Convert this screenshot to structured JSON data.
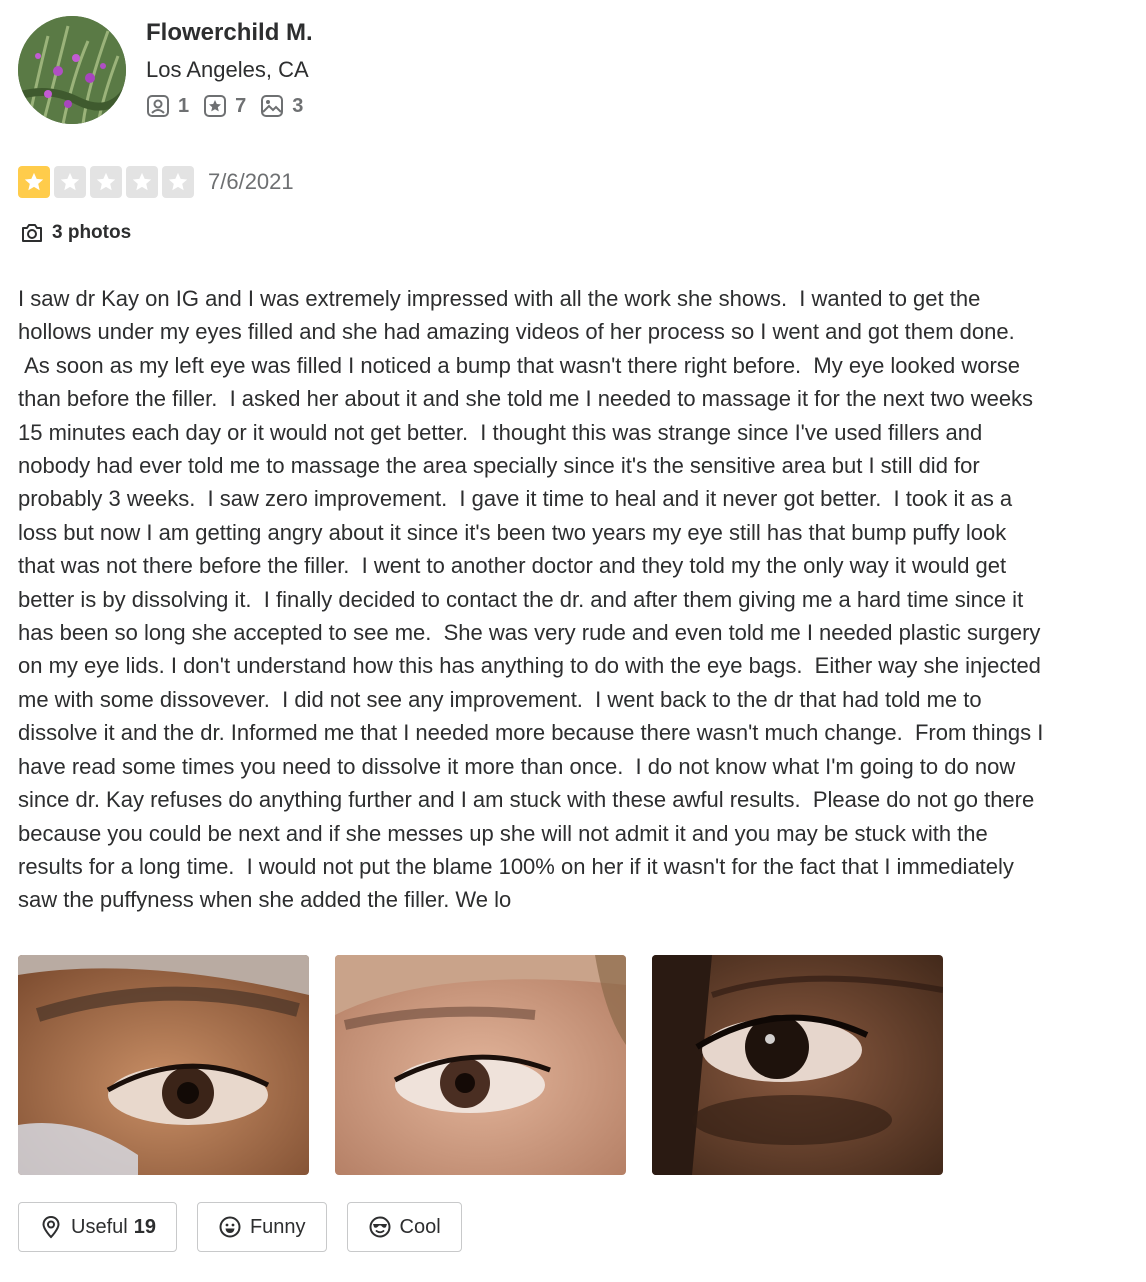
{
  "user": {
    "name": "Flowerchild M.",
    "location": "Los Angeles, CA",
    "friends_count": "1",
    "reviews_count": "7",
    "photos_count": "3"
  },
  "review": {
    "rating": 1,
    "rating_max": 5,
    "date": "7/6/2021",
    "photo_label": "3 photos",
    "text": "I saw dr Kay on IG and I was extremely impressed with all the work she shows.  I wanted to get the\nhollows under my eyes filled and she had amazing videos of her process so I went and got them done.\n As soon as my left eye was filled I noticed a bump that wasn't there right before.  My eye looked worse\nthan before the filler.  I asked her about it and she told me I needed to massage it for the next two weeks\n15 minutes each day or it would not get better.  I thought this was strange since I've used fillers and\nnobody had ever told me to massage the area specially since it's the sensitive area but I still did for\nprobably 3 weeks.  I saw zero improvement.  I gave it time to heal and it never got better.  I took it as a\nloss but now I am getting angry about it since it's been two years my eye still has that bump puffy look\nthat was not there before the filler.  I went to another doctor and they told my the only way it would get\nbetter is by dissolving it.  I finally decided to contact the dr. and after them giving me a hard time since it\nhas been so long she accepted to see me.  She was very rude and even told me I needed plastic surgery\non my eye lids. I don't understand how this has anything to do with the eye bags.  Either way she injected\nme with some dissovever.  I did not see any improvement.  I went back to the dr that had told me to\ndissolve it and the dr. Informed me that I needed more because there wasn't much change.  From things I\nhave read some times you need to dissolve it more than once.  I do not know what I'm going to do now\nsince dr. Kay refuses do anything further and I am stuck with these awful results.  Please do not go there\nbecause you could be next and if she messes up she will not admit it and you may be stuck with the\nresults for a long time.  I would not put the blame 100% on her if it wasn't for the fact that I immediately\nsaw the puffyness when she added the filler. We lo"
  },
  "actions": {
    "useful_label": "Useful",
    "useful_count": "19",
    "funny_label": "Funny",
    "cool_label": "Cool"
  },
  "icons": {
    "friends": "friends-icon",
    "reviews": "star-review-icon",
    "photos": "photo-icon",
    "camera": "camera-icon",
    "useful": "lightbulb-pin-icon",
    "funny": "smiley-icon",
    "cool": "sunglasses-smiley-icon"
  },
  "colors": {
    "star_filled": "#ffcc4b",
    "star_empty": "#e3e3e3",
    "text": "#2d2e2f",
    "muted": "#6e7072"
  }
}
